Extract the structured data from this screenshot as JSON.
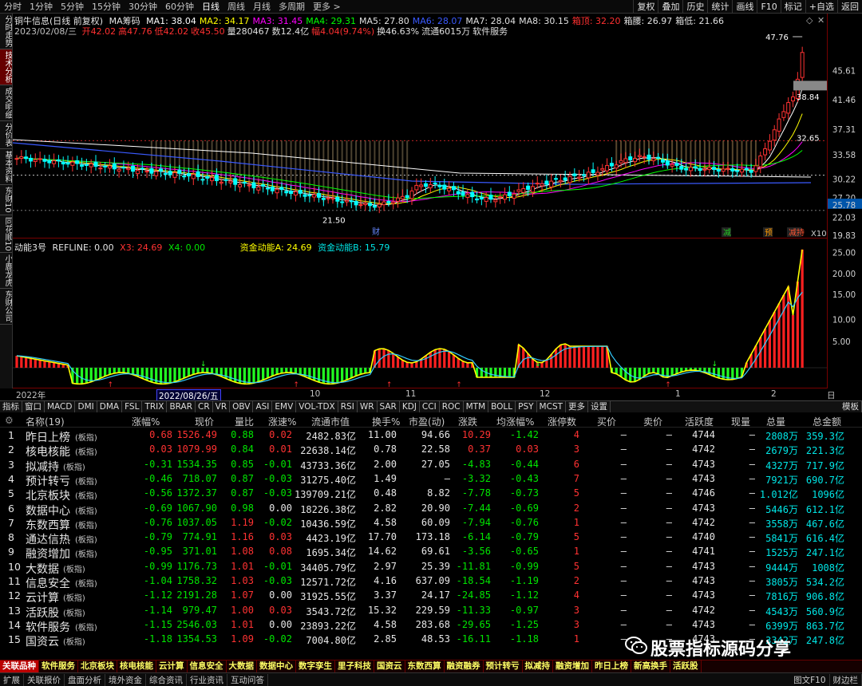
{
  "toolbar": {
    "timeframes": [
      "分时",
      "1分钟",
      "5分钟",
      "15分钟",
      "30分钟",
      "60分钟",
      "日线",
      "周线",
      "月线",
      "多周期",
      "更多 >"
    ],
    "active": "日线",
    "right": [
      "复权",
      "叠加",
      "历史",
      "统计",
      "画线",
      "F10",
      "标记",
      "+自选",
      "返回"
    ]
  },
  "left_tabs": [
    "分时走势",
    "技术分析",
    "成交明细",
    "分价表",
    "基本资料",
    "东财10",
    "同花顺10",
    "小鹿龙虎",
    "东财公司"
  ],
  "main": {
    "title": "铜牛信息(日线 前复权)",
    "ma_label": "MA筹码",
    "ma": [
      {
        "label": "MA1: 38.04",
        "color": "#ffffff"
      },
      {
        "label": "MA2: 34.17",
        "color": "#ffff00"
      },
      {
        "label": "MA3: 31.45",
        "color": "#ff00ff"
      },
      {
        "label": "MA4: 29.31",
        "color": "#00ff00"
      },
      {
        "label": "MA5: 27.80",
        "color": "#e0e0e0"
      },
      {
        "label": "MA6: 28.07",
        "color": "#3a5aff"
      },
      {
        "label": "MA7: 28.04",
        "color": "#e0e0e0"
      },
      {
        "label": "MA8: 30.15",
        "color": "#e0e0e0"
      },
      {
        "label": "箱顶: 32.20",
        "color": "#ff3030"
      },
      {
        "label": "箱腰: 26.97",
        "color": "#e0e0e0"
      },
      {
        "label": "箱低: 21.66",
        "color": "#e0e0e0"
      }
    ],
    "date_line": "2023/02/08/三",
    "ohlc": [
      {
        "label": "开42.02",
        "color": "#ff3030"
      },
      {
        "label": "高47.76",
        "color": "#ff3030"
      },
      {
        "label": "低42.02",
        "color": "#ff3030"
      },
      {
        "label": "收45.50",
        "color": "#ff3030"
      },
      {
        "label": "量280467",
        "color": "#e0e0e0"
      },
      {
        "label": "数12.4亿",
        "color": "#e0e0e0"
      },
      {
        "label": "幅4.04(9.74%)",
        "color": "#ff3030"
      },
      {
        "label": "换46.63%",
        "color": "#e0e0e0"
      },
      {
        "label": "流通6015万",
        "color": "#e0e0e0"
      },
      {
        "label": "软件服务",
        "color": "#e0e0e0"
      }
    ],
    "annotations": {
      "high": "47.76",
      "low": "21.50",
      "mid1": "38.84",
      "mid2": "32.65",
      "cai": "财",
      "flags": [
        "减",
        "预",
        "减持"
      ],
      "x10": "X10"
    }
  },
  "axis": {
    "main_ticks": [
      "45.61",
      "41.46",
      "37.31",
      "33.58",
      "30.22",
      "27.20",
      "25.78",
      "22.03",
      "19.83"
    ],
    "sub_ticks": [
      "25.00",
      "20.00",
      "15.00",
      "10.00",
      "5.00"
    ]
  },
  "sub": {
    "title": "动能3号",
    "refline": "REFLINE: 0.00",
    "x3": "X3: 24.69",
    "x4": "X4: 0.00",
    "a": "资金动能A: 24.69",
    "b": "资金动能B: 15.79"
  },
  "xaxis": {
    "labels": [
      "2022年",
      "2022/08/26/五",
      "10",
      "11",
      "12",
      "1",
      "2",
      "日线"
    ]
  },
  "indicators": [
    "指标",
    "窗口",
    "MACD",
    "DMI",
    "DMA",
    "FSL",
    "TRIX",
    "BRAR",
    "CR",
    "VR",
    "OBV",
    "ASI",
    "EMV",
    "VOL-TDX",
    "RSI",
    "WR",
    "SAR",
    "KDJ",
    "CCI",
    "ROC",
    "MTM",
    "BOLL",
    "PSY",
    "MCST",
    "更多",
    "设置"
  ],
  "indicators_right": "模板",
  "table": {
    "headers": [
      "名称(19)",
      "涨幅%",
      "现价",
      "量比",
      "涨速%",
      "流通市值",
      "换手%",
      "市盈(动)",
      "涨跌",
      "均涨幅%",
      "涨停数",
      "买价",
      "卖价",
      "活跃度",
      "现量",
      "总量",
      "总金额"
    ],
    "rows": [
      [
        "1",
        "昨日上榜",
        "0.68",
        "1526.49",
        "0.88",
        "0.02",
        "2482.83亿",
        "11.00",
        "94.66",
        "10.29",
        "-1.42",
        "4",
        "—",
        "—",
        "4744",
        "—",
        "2808万",
        "359.3亿"
      ],
      [
        "2",
        "核电核能",
        "0.03",
        "1079.99",
        "0.84",
        "0.01",
        "22638.14亿",
        "0.78",
        "22.58",
        "0.37",
        "0.03",
        "3",
        "—",
        "—",
        "4742",
        "—",
        "2679万",
        "221.3亿"
      ],
      [
        "3",
        "拟减持",
        "-0.31",
        "1534.35",
        "0.85",
        "-0.01",
        "43733.36亿",
        "2.00",
        "27.05",
        "-4.83",
        "-0.44",
        "6",
        "—",
        "—",
        "4743",
        "—",
        "4327万",
        "717.9亿"
      ],
      [
        "4",
        "预计转亏",
        "-0.46",
        "718.07",
        "0.87",
        "-0.03",
        "31275.40亿",
        "1.49",
        "—",
        "-3.32",
        "-0.43",
        "7",
        "—",
        "—",
        "4743",
        "—",
        "7921万",
        "690.7亿"
      ],
      [
        "5",
        "北京板块",
        "-0.56",
        "1372.37",
        "0.87",
        "-0.03",
        "139709.21亿",
        "0.48",
        "8.82",
        "-7.78",
        "-0.73",
        "5",
        "—",
        "—",
        "4746",
        "—",
        "1.012亿",
        "1096亿"
      ],
      [
        "6",
        "数据中心",
        "-0.69",
        "1067.90",
        "0.98",
        "0.00",
        "18226.38亿",
        "2.82",
        "20.90",
        "-7.44",
        "-0.69",
        "2",
        "—",
        "—",
        "4743",
        "—",
        "5446万",
        "612.1亿"
      ],
      [
        "7",
        "东数西算",
        "-0.76",
        "1037.05",
        "1.19",
        "-0.02",
        "10436.59亿",
        "4.58",
        "60.09",
        "-7.94",
        "-0.76",
        "1",
        "—",
        "—",
        "4742",
        "—",
        "3558万",
        "467.6亿"
      ],
      [
        "8",
        "通达信热",
        "-0.79",
        "774.91",
        "1.16",
        "0.03",
        "4423.19亿",
        "17.70",
        "173.18",
        "-6.14",
        "-0.79",
        "5",
        "—",
        "—",
        "4740",
        "—",
        "5841万",
        "616.4亿"
      ],
      [
        "9",
        "融资增加",
        "-0.95",
        "371.01",
        "1.08",
        "0.08",
        "1695.34亿",
        "14.62",
        "69.61",
        "-3.56",
        "-0.65",
        "1",
        "—",
        "—",
        "4741",
        "—",
        "1525万",
        "247.1亿"
      ],
      [
        "10",
        "大数据",
        "-0.99",
        "1176.73",
        "1.01",
        "-0.01",
        "34405.79亿",
        "2.97",
        "25.39",
        "-11.81",
        "-0.99",
        "5",
        "—",
        "—",
        "4743",
        "—",
        "9444万",
        "1008亿"
      ],
      [
        "11",
        "信息安全",
        "-1.04",
        "1758.32",
        "1.03",
        "-0.03",
        "12571.72亿",
        "4.16",
        "637.09",
        "-18.54",
        "-1.19",
        "2",
        "—",
        "—",
        "4743",
        "—",
        "3805万",
        "534.2亿"
      ],
      [
        "12",
        "云计算",
        "-1.12",
        "2191.28",
        "1.07",
        "0.00",
        "31925.55亿",
        "3.37",
        "24.17",
        "-24.85",
        "-1.12",
        "4",
        "—",
        "—",
        "4743",
        "—",
        "7816万",
        "906.8亿"
      ],
      [
        "13",
        "活跃股",
        "-1.14",
        "979.47",
        "1.00",
        "0.03",
        "3543.72亿",
        "15.32",
        "229.59",
        "-11.33",
        "-0.97",
        "3",
        "—",
        "—",
        "4742",
        "—",
        "4543万",
        "560.9亿"
      ],
      [
        "14",
        "软件服务",
        "-1.15",
        "2546.03",
        "1.01",
        "0.00",
        "23893.22亿",
        "4.58",
        "283.68",
        "-29.65",
        "-1.25",
        "3",
        "—",
        "—",
        "4743",
        "—",
        "6399万",
        "863.7亿"
      ],
      [
        "15",
        "国资云",
        "-1.18",
        "1354.53",
        "1.09",
        "-0.02",
        "7004.80亿",
        "2.85",
        "48.53",
        "-16.11",
        "-1.18",
        "1",
        "—",
        "—",
        "4743",
        "—",
        "3342万",
        "247.8亿"
      ]
    ],
    "row_tag": "(板指)"
  },
  "sectors": [
    "关联品种",
    "软件服务",
    "北京板块",
    "核电核能",
    "云计算",
    "信息安全",
    "大数据",
    "数据中心",
    "数字孪生",
    "里子科技",
    "国资云",
    "东数西算",
    "融资融券",
    "预计转亏",
    "拟减持",
    "融资增加",
    "昨日上榜",
    "新高换手",
    "活跃股"
  ],
  "bottom": {
    "left": [
      "扩展",
      "关联报价",
      "盘面分析",
      "境外资金",
      "综合资讯",
      "行业资讯",
      "互动问答"
    ],
    "right": [
      "图文F10",
      "财边栏"
    ]
  },
  "watermark": "股票指标源码分享",
  "colors": {
    "up": "#ff3232",
    "down": "#00e600",
    "box_top": "#ff3030"
  }
}
